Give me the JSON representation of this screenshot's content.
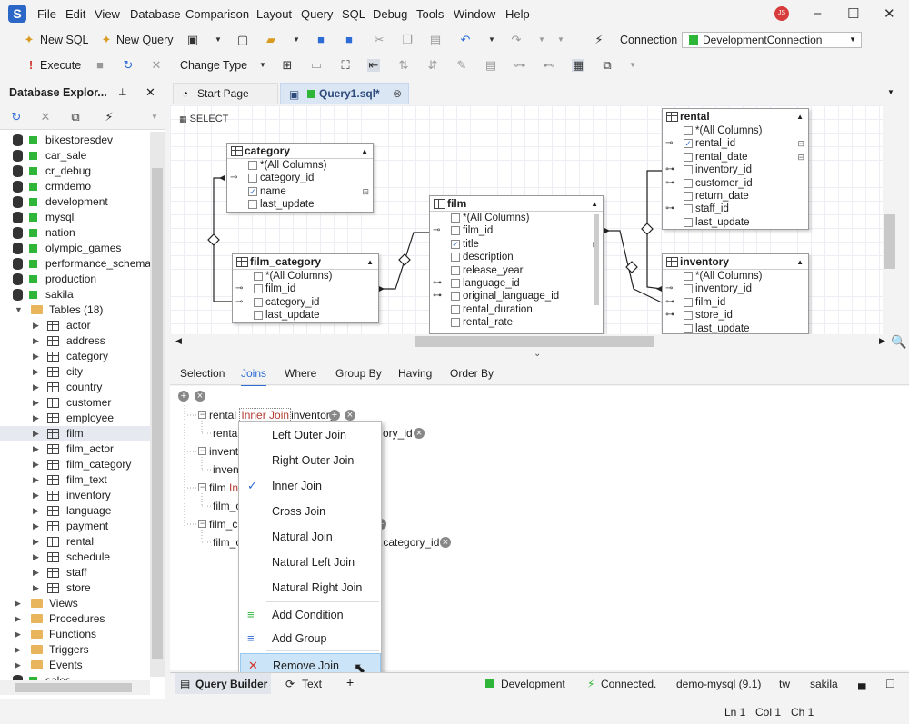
{
  "menu": [
    "File",
    "Edit",
    "View",
    "Database",
    "Comparison",
    "Layout",
    "Query",
    "SQL",
    "Debug",
    "Tools",
    "Window",
    "Help"
  ],
  "user_initials": "JS",
  "toolbar1": {
    "new_sql": "New SQL",
    "new_query": "New Query",
    "connection_label": "Connection",
    "connection_value": "DevelopmentConnection"
  },
  "toolbar2": {
    "execute": "Execute",
    "change_type": "Change Type"
  },
  "left_panel": {
    "title": "Database Explor...",
    "items": [
      {
        "label": "bikestoresdev",
        "kind": "db"
      },
      {
        "label": "car_sale",
        "kind": "db"
      },
      {
        "label": "cr_debug",
        "kind": "db"
      },
      {
        "label": "crmdemo",
        "kind": "db"
      },
      {
        "label": "development",
        "kind": "db"
      },
      {
        "label": "mysql",
        "kind": "db"
      },
      {
        "label": "nation",
        "kind": "db"
      },
      {
        "label": "olympic_games",
        "kind": "db"
      },
      {
        "label": "performance_schema",
        "kind": "db"
      },
      {
        "label": "production",
        "kind": "db"
      },
      {
        "label": "sakila",
        "kind": "db"
      },
      {
        "label": "Tables (18)",
        "kind": "folder-open"
      },
      {
        "label": "actor",
        "kind": "table"
      },
      {
        "label": "address",
        "kind": "table"
      },
      {
        "label": "category",
        "kind": "table"
      },
      {
        "label": "city",
        "kind": "table"
      },
      {
        "label": "country",
        "kind": "table"
      },
      {
        "label": "customer",
        "kind": "table"
      },
      {
        "label": "employee",
        "kind": "table"
      },
      {
        "label": "film",
        "kind": "table"
      },
      {
        "label": "film_actor",
        "kind": "table"
      },
      {
        "label": "film_category",
        "kind": "table"
      },
      {
        "label": "film_text",
        "kind": "table"
      },
      {
        "label": "inventory",
        "kind": "table"
      },
      {
        "label": "language",
        "kind": "table"
      },
      {
        "label": "payment",
        "kind": "table"
      },
      {
        "label": "rental",
        "kind": "table"
      },
      {
        "label": "schedule",
        "kind": "table"
      },
      {
        "label": "staff",
        "kind": "table"
      },
      {
        "label": "store",
        "kind": "table"
      },
      {
        "label": "Views",
        "kind": "folder"
      },
      {
        "label": "Procedures",
        "kind": "folder"
      },
      {
        "label": "Functions",
        "kind": "folder"
      },
      {
        "label": "Triggers",
        "kind": "folder"
      },
      {
        "label": "Events",
        "kind": "folder"
      },
      {
        "label": "sales",
        "kind": "db"
      }
    ]
  },
  "doc_tabs": {
    "start": "Start Page",
    "query": "Query1.sql*"
  },
  "canvas": {
    "select_label": "SELECT",
    "entities": {
      "category": {
        "title": "category",
        "rows": [
          "*(All Columns)",
          "category_id",
          "name",
          "last_update"
        ]
      },
      "film_category": {
        "title": "film_category",
        "rows": [
          "*(All Columns)",
          "film_id",
          "category_id",
          "last_update"
        ]
      },
      "film": {
        "title": "film",
        "rows": [
          "*(All Columns)",
          "film_id",
          "title",
          "description",
          "release_year",
          "language_id",
          "original_language_id",
          "rental_duration",
          "rental_rate"
        ]
      },
      "rental": {
        "title": "rental",
        "rows": [
          "*(All Columns)",
          "rental_id",
          "rental_date",
          "inventory_id",
          "customer_id",
          "return_date",
          "staff_id",
          "last_update"
        ]
      },
      "inventory": {
        "title": "inventory",
        "rows": [
          "*(All Columns)",
          "inventory_id",
          "film_id",
          "store_id",
          "last_update"
        ]
      }
    }
  },
  "subtabs": [
    "Selection",
    "Joins",
    "Where",
    "Group By",
    "Having",
    "Order By"
  ],
  "joins": {
    "row1_left": "rental",
    "row1_type": "Inner Join",
    "row1_right": "inventory",
    "row1_cond_left": "rental",
    "row1_cond_right": "ory_id",
    "row2_left": "invento",
    "row2_cond": "invent",
    "row3_left": "film",
    "row3_type": "Inn",
    "row3_cond": "film_ca",
    "row4_left": "film_ca",
    "row4_cond_left": "film_ca",
    "row4_cond_right": ".category_id"
  },
  "context_menu": [
    "Left Outer Join",
    "Right Outer Join",
    "Inner Join",
    "Cross Join",
    "Natural Join",
    "Natural Left Join",
    "Natural Right Join",
    "Add Condition",
    "Add Group",
    "Remove Join"
  ],
  "bottom_tabs": {
    "query_builder": "Query Builder",
    "text": "Text",
    "conn": "Development",
    "status": "Connected.",
    "server": "demo-mysql (9.1)",
    "user": "tw",
    "db": "sakila"
  },
  "status": {
    "ln": "Ln 1",
    "col": "Col 1",
    "ch": "Ch 1"
  },
  "colors": {
    "accent": "#2d6bd6",
    "conn_green": "#2fb537",
    "inner_join_red": "#b03a2e"
  }
}
